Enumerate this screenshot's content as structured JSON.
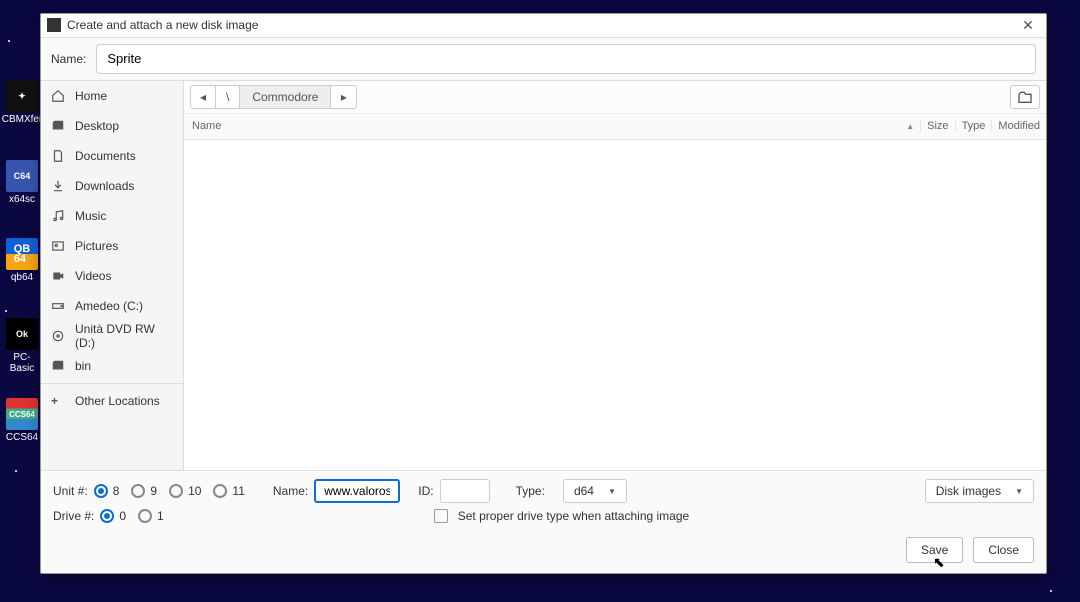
{
  "dialog": {
    "title": "Create and attach a new disk image",
    "name_label": "Name:",
    "name_value": "Sprite"
  },
  "sidebar": {
    "items": [
      {
        "label": "Home"
      },
      {
        "label": "Desktop"
      },
      {
        "label": "Documents"
      },
      {
        "label": "Downloads"
      },
      {
        "label": "Music"
      },
      {
        "label": "Pictures"
      },
      {
        "label": "Videos"
      },
      {
        "label": "Amedeo (C:)"
      },
      {
        "label": "Unità DVD RW (D:)"
      },
      {
        "label": "bin"
      }
    ],
    "other": "Other Locations"
  },
  "path": {
    "root": "\\",
    "current": "Commodore"
  },
  "columns": {
    "name": "Name",
    "size": "Size",
    "type": "Type",
    "modified": "Modified"
  },
  "bottom": {
    "unit_label": "Unit #:",
    "units": [
      "8",
      "9",
      "10",
      "11"
    ],
    "unit_selected": "8",
    "drive_label": "Drive #:",
    "drives": [
      "0",
      "1"
    ],
    "drive_selected": "0",
    "name2_label": "Name:",
    "name2_value": "www.valoroso.it",
    "id_label": "ID:",
    "id_value": "",
    "type_label": "Type:",
    "type_value": "d64",
    "filter_value": "Disk images",
    "checkbox_label": "Set proper drive type when attaching image"
  },
  "buttons": {
    "save": "Save",
    "close": "Close"
  },
  "desktop": {
    "l0": "CBMXfer",
    "l1": "x64sc",
    "l2": "qb64",
    "l3": "PC-Basic",
    "l4": "CCS64"
  }
}
